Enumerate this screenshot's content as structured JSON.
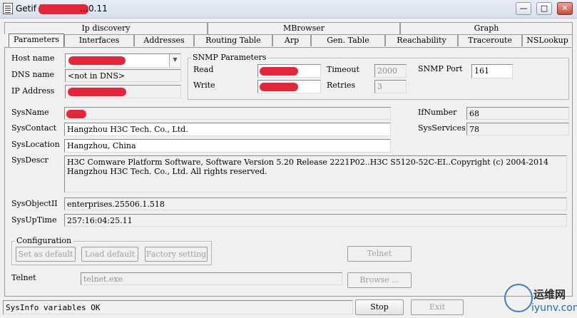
{
  "window": {
    "title": "Getif [",
    "title_tail": "…0.11",
    "minimize": "—",
    "maximize": "□",
    "close": "✕"
  },
  "tabs_row1": [
    {
      "label": "Ip discovery"
    },
    {
      "label": "MBrowser"
    },
    {
      "label": "Graph"
    }
  ],
  "tabs_row2": [
    {
      "label": "Parameters"
    },
    {
      "label": "Interfaces"
    },
    {
      "label": "Addresses"
    },
    {
      "label": "Routing Table"
    },
    {
      "label": "Arp"
    },
    {
      "label": "Gen. Table"
    },
    {
      "label": "Reachability"
    },
    {
      "label": "Traceroute"
    },
    {
      "label": "NSLookup"
    }
  ],
  "host": {
    "host_label": "Host name",
    "dns_label": "DNS name",
    "dns_value": "<not in DNS>",
    "ip_label": "IP Address"
  },
  "snmp": {
    "group_title": "SNMP Parameters",
    "read_label": "Read",
    "write_label": "Write",
    "timeout_label": "Timeout",
    "timeout_value": "2000",
    "retries_label": "Retries",
    "retries_value": "3",
    "port_label": "SNMP Port",
    "port_value": "161"
  },
  "sys": {
    "name_label": "SysName",
    "contact_label": "SysContact",
    "contact_value": "Hangzhou H3C Tech. Co., Ltd.",
    "location_label": "SysLocation",
    "location_value": "Hangzhou, China",
    "descr_label": "SysDescr",
    "descr_line1": "H3C Comware Platform Software, Software Version 5.20 Release 2221P02..H3C S5120-52C-EI..Copyright (c) 2004-2014",
    "descr_line2": "Hangzhou H3C Tech. Co., Ltd. All rights reserved.",
    "objectid_label": "SysObjectII",
    "objectid_value": "enterprises.25506.1.518",
    "uptime_label": "SysUpTime",
    "uptime_value": "257:16:04:25.11",
    "ifnumber_label": "IfNumber",
    "ifnumber_value": "68",
    "services_label": "SysServices",
    "services_value": "78"
  },
  "config": {
    "group_title": "Configuration",
    "set_default": "Set as default",
    "load_default": "Load default",
    "factory": "Factory setting",
    "telnet_button": "Telnet"
  },
  "telnet": {
    "label": "Telnet",
    "path_value": "telnet.exe",
    "browse": "Browse ..."
  },
  "statusbar": {
    "text": "SysInfo variables OK",
    "stop": "Stop",
    "exit": "Exit"
  },
  "watermark": {
    "cn": "运维网",
    "url": "iyunv.com"
  }
}
